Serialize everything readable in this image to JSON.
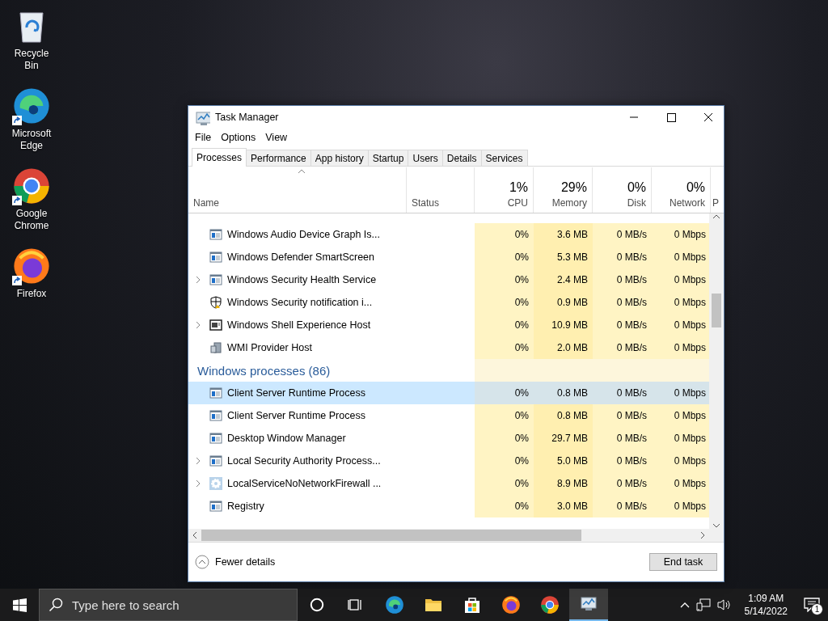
{
  "desktop_icons": [
    {
      "label": "Recycle Bin",
      "kind": "recycle",
      "shortcut": false
    },
    {
      "label": "Microsoft Edge",
      "kind": "edge",
      "shortcut": true
    },
    {
      "label": "Google Chrome",
      "kind": "chrome",
      "shortcut": true
    },
    {
      "label": "Firefox",
      "kind": "firefox",
      "shortcut": true
    }
  ],
  "window": {
    "title": "Task Manager",
    "menu": [
      "File",
      "Options",
      "View"
    ],
    "tabs": [
      {
        "label": "Processes",
        "selected": true
      },
      {
        "label": "Performance",
        "selected": false
      },
      {
        "label": "App history",
        "selected": false
      },
      {
        "label": "Startup",
        "selected": false
      },
      {
        "label": "Users",
        "selected": false
      },
      {
        "label": "Details",
        "selected": false
      },
      {
        "label": "Services",
        "selected": false
      }
    ],
    "columns": [
      {
        "label": "Name",
        "sorted": true
      },
      {
        "label": "Status",
        "sorted": false
      },
      {
        "label": "CPU",
        "usage": "1%",
        "sorted": false
      },
      {
        "label": "Memory",
        "usage": "29%",
        "sorted": false
      },
      {
        "label": "Disk",
        "usage": "0%",
        "sorted": false
      },
      {
        "label": "Network",
        "usage": "0%",
        "sorted": false
      },
      {
        "label": "P",
        "sorted": false
      }
    ],
    "rows": [
      {
        "kind": "app",
        "name": "Windows Audio Device Graph Is...",
        "expandable": false,
        "selected": false,
        "cpu": "0%",
        "memory": "3.6 MB",
        "disk": "0 MB/s",
        "network": "0 Mbps"
      },
      {
        "kind": "app",
        "name": "Windows Defender SmartScreen",
        "expandable": false,
        "selected": false,
        "cpu": "0%",
        "memory": "5.3 MB",
        "disk": "0 MB/s",
        "network": "0 Mbps"
      },
      {
        "kind": "app",
        "name": "Windows Security Health Service",
        "expandable": true,
        "selected": false,
        "cpu": "0%",
        "memory": "2.4 MB",
        "disk": "0 MB/s",
        "network": "0 Mbps"
      },
      {
        "kind": "security",
        "name": "Windows Security notification i...",
        "expandable": false,
        "selected": false,
        "cpu": "0%",
        "memory": "0.9 MB",
        "disk": "0 MB/s",
        "network": "0 Mbps"
      },
      {
        "kind": "shell",
        "name": "Windows Shell Experience Host",
        "expandable": true,
        "selected": false,
        "cpu": "0%",
        "memory": "10.9 MB",
        "disk": "0 MB/s",
        "network": "0 Mbps"
      },
      {
        "kind": "provider",
        "name": "WMI Provider Host",
        "expandable": false,
        "selected": false,
        "cpu": "0%",
        "memory": "2.0 MB",
        "disk": "0 MB/s",
        "network": "0 Mbps"
      },
      {
        "kind": "group",
        "label": "Windows processes (86)"
      },
      {
        "kind": "app",
        "name": "Client Server Runtime Process",
        "expandable": false,
        "selected": true,
        "cpu": "0%",
        "memory": "0.8 MB",
        "disk": "0 MB/s",
        "network": "0 Mbps"
      },
      {
        "kind": "app",
        "name": "Client Server Runtime Process",
        "expandable": false,
        "selected": false,
        "cpu": "0%",
        "memory": "0.8 MB",
        "disk": "0 MB/s",
        "network": "0 Mbps"
      },
      {
        "kind": "app",
        "name": "Desktop Window Manager",
        "expandable": false,
        "selected": false,
        "cpu": "0%",
        "memory": "29.7 MB",
        "disk": "0 MB/s",
        "network": "0 Mbps"
      },
      {
        "kind": "app",
        "name": "Local Security Authority Process...",
        "expandable": true,
        "selected": false,
        "cpu": "0%",
        "memory": "5.0 MB",
        "disk": "0 MB/s",
        "network": "0 Mbps"
      },
      {
        "kind": "service",
        "name": "LocalServiceNoNetworkFirewall ...",
        "expandable": true,
        "selected": false,
        "cpu": "0%",
        "memory": "8.9 MB",
        "disk": "0 MB/s",
        "network": "0 Mbps"
      },
      {
        "kind": "app",
        "name": "Registry",
        "expandable": false,
        "selected": false,
        "cpu": "0%",
        "memory": "3.0 MB",
        "disk": "0 MB/s",
        "network": "0 Mbps"
      }
    ],
    "fewer_details": "Fewer details",
    "end_task": "End task"
  },
  "taskbar": {
    "search_placeholder": "Type here to search",
    "apps": [
      {
        "kind": "cortana",
        "active": false
      },
      {
        "kind": "taskview",
        "active": false
      },
      {
        "kind": "edge",
        "active": false
      },
      {
        "kind": "folder",
        "active": false
      },
      {
        "kind": "store",
        "active": false
      },
      {
        "kind": "firefox",
        "active": false
      },
      {
        "kind": "chrome",
        "active": false
      },
      {
        "kind": "taskmanager",
        "active": true
      }
    ],
    "time": "1:09 AM",
    "date": "5/14/2022",
    "notification_count": "1"
  }
}
